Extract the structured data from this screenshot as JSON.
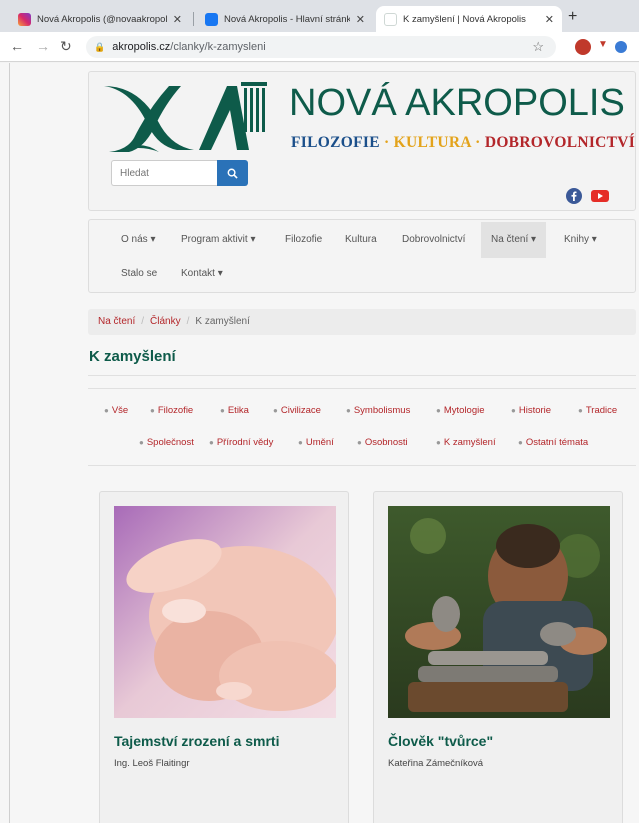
{
  "browser": {
    "tabs": [
      {
        "title": "Nová Akropolis (@novaakropolis",
        "icon": "instagram-icon"
      },
      {
        "title": "Nová Akropolis - Hlavní stránka",
        "icon": "facebook-icon"
      },
      {
        "title": "K zamyšlení | Nová Akropolis",
        "icon": "akropolis-favicon"
      }
    ],
    "url_domain": "akropolis.cz",
    "url_path": "/clanky/k-zamysleni"
  },
  "header": {
    "brand": "NOVÁ AKROPOLIS",
    "tagline": {
      "part1": "FILOZOFIE",
      "part2": "KULTURA",
      "part3": "DOBROVOLNICTVÍ",
      "sep": " · "
    },
    "search_placeholder": "Hledat"
  },
  "nav": {
    "items": [
      {
        "label": "O nás ▾"
      },
      {
        "label": "Program aktivit ▾"
      },
      {
        "label": "Filozofie"
      },
      {
        "label": "Kultura"
      },
      {
        "label": "Dobrovolnictví"
      },
      {
        "label": "Na čtení ▾"
      },
      {
        "label": "Knihy ▾"
      },
      {
        "label": "Stalo se"
      },
      {
        "label": "Kontakt ▾"
      }
    ]
  },
  "breadcrumb": {
    "items": [
      "Na čtení",
      "Články"
    ],
    "current": "K zamyšlení",
    "sep": "/"
  },
  "section_title": "K zamyšlení",
  "categories": [
    "Vše",
    "Filozofie",
    "Etika",
    "Civilizace",
    "Symbolismus",
    "Mytologie",
    "Historie",
    "Tradice",
    "Společnost",
    "Přírodní vědy",
    "Umění",
    "Osobnosti",
    "K zamyšlení",
    "Ostatní témata"
  ],
  "cards": [
    {
      "title": "Tajemství zrození a smrti",
      "author": "Ing. Leoš Flaitingr"
    },
    {
      "title": "Člověk \"tvůrce\"",
      "author": "Kateřina Zámečníková"
    }
  ],
  "colors": {
    "accent_green": "#0e5b4a",
    "link_red": "#b3262a",
    "search_blue": "#2a72b8"
  }
}
